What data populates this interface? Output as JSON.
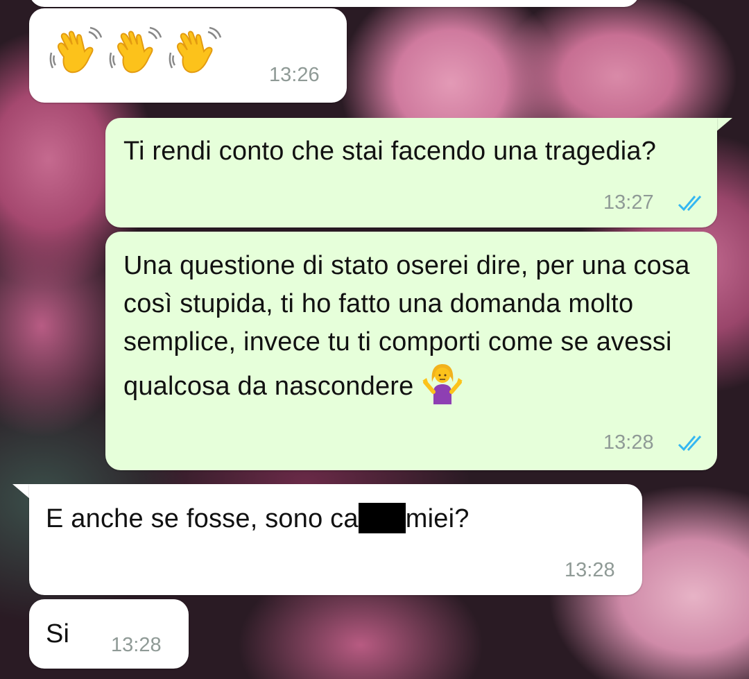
{
  "messages": [
    {
      "id": "m0",
      "direction": "incoming",
      "text": "",
      "time": ""
    },
    {
      "id": "m1",
      "direction": "incoming",
      "emoji": "waving-hand x3",
      "time": "13:26"
    },
    {
      "id": "m2",
      "direction": "outgoing",
      "text": "Ti rendi conto che stai facendo una tragedia?",
      "time": "13:27",
      "status": "read"
    },
    {
      "id": "m3",
      "direction": "outgoing",
      "text": "Una questione di stato oserei dire, per una cosa così stupida, ti ho fatto una domanda molto semplice, invece tu ti comporti come se avessi qualcosa da nascondere",
      "emoji": "person-shrugging",
      "time": "13:28",
      "status": "read"
    },
    {
      "id": "m4",
      "direction": "incoming",
      "text_before": "E anche se fosse, sono ca",
      "text_after": "miei?",
      "redacted": true,
      "time": "13:28"
    },
    {
      "id": "m5",
      "direction": "incoming",
      "text": "Si",
      "time": "13:28"
    }
  ],
  "colors": {
    "incoming_bubble": "#ffffff",
    "outgoing_bubble": "#e6ffda",
    "read_ticks": "#34b7f1",
    "timestamp": "#8f9a96"
  }
}
